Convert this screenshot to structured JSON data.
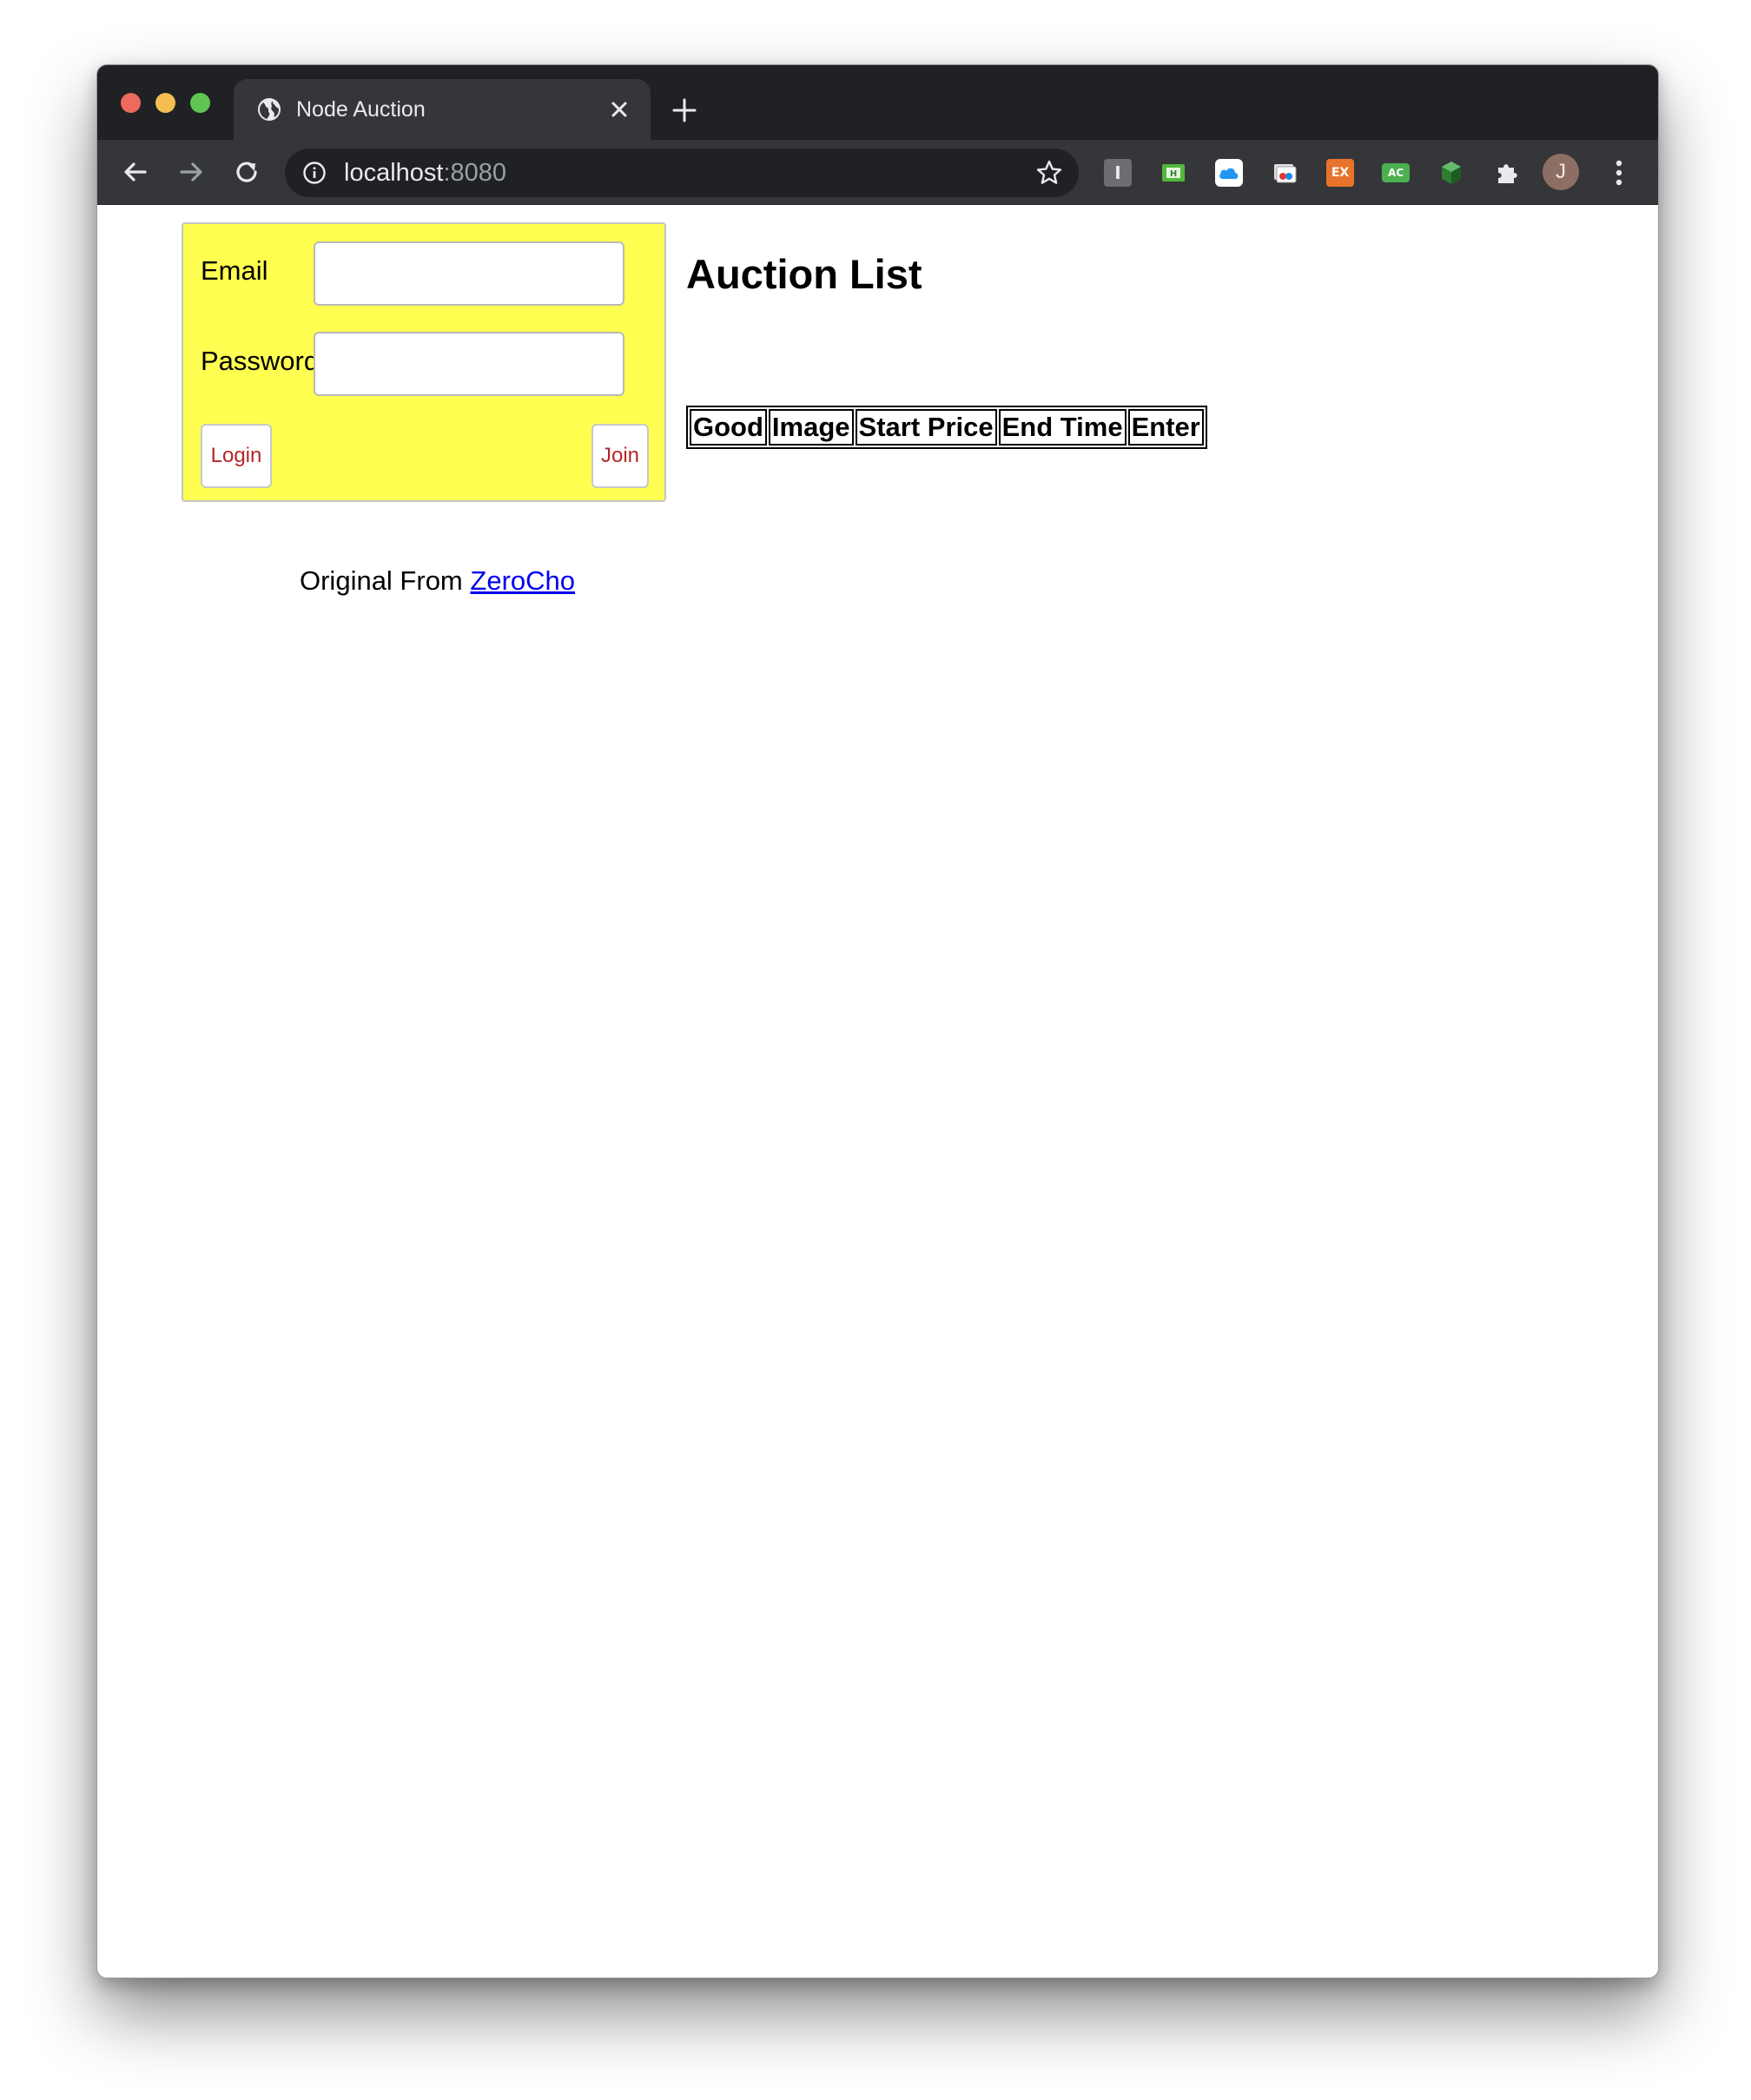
{
  "browser": {
    "tab": {
      "title": "Node Auction",
      "favicon": "globe-icon",
      "close": "close-icon"
    },
    "new_tab": "plus-icon",
    "nav": {
      "back": "back-arrow-icon",
      "forward": "forward-arrow-icon",
      "reload": "reload-icon"
    },
    "address": {
      "host": "localhost",
      "port": ":8080",
      "info": "info-icon",
      "star": "bookmark-star-icon"
    },
    "extensions": [
      {
        "icon": "extension-i-icon",
        "label": "I",
        "color": "#5f6368"
      },
      {
        "icon": "extension-green-h-icon",
        "label": "H",
        "color": "#52b83a"
      },
      {
        "icon": "extension-cloud-icon",
        "label": "",
        "color": "#1e88e5"
      },
      {
        "icon": "extension-screenshot-icon",
        "label": "",
        "color": "#f0f0f0"
      },
      {
        "icon": "extension-ex-icon",
        "label": "EX",
        "color": "#e8732c"
      },
      {
        "icon": "extension-ac-icon",
        "label": "AC",
        "color": "#4caf50"
      },
      {
        "icon": "extension-cube-icon",
        "label": "",
        "color": "#34a853"
      },
      {
        "icon": "extensions-puzzle-icon",
        "label": "",
        "color": "#e8eaed"
      }
    ],
    "profile_initial": "J",
    "menu": "more-vertical-icon"
  },
  "login": {
    "email_label": "Email",
    "email_value": "",
    "password_label": "Password",
    "password_value": "",
    "login_button": "Login",
    "join_button": "Join"
  },
  "credit": {
    "prefix": "Original From",
    "link_text": "ZeroCho"
  },
  "auction": {
    "title": "Auction List",
    "columns": [
      "Good",
      "Image",
      "Start Price",
      "End Time",
      "Enter"
    ]
  }
}
